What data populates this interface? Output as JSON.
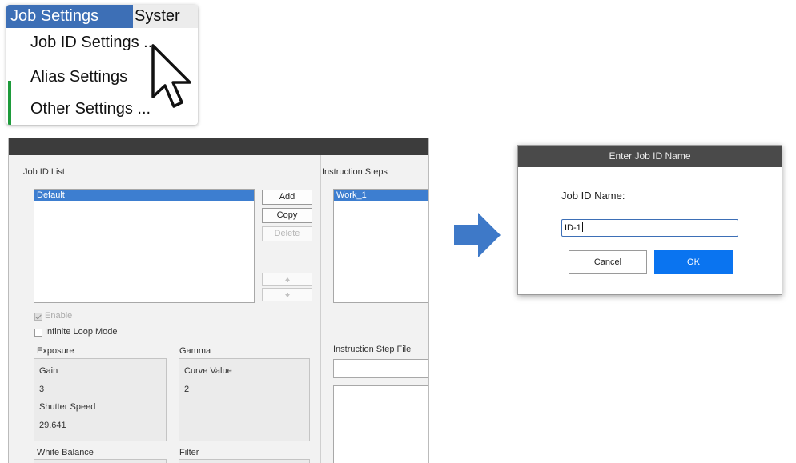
{
  "menu": {
    "active_menu": "Job Settings",
    "next_menu": "Syster",
    "items": [
      "Job ID Settings ...",
      "Alias Settings",
      "Other Settings ..."
    ]
  },
  "main_window": {
    "job_id_list_label": "Job ID List",
    "job_id_list": [
      "Default"
    ],
    "add_label": "Add",
    "copy_label": "Copy",
    "delete_label": "Delete",
    "up_icon": "arrow-up-icon",
    "down_icon": "arrow-down-icon",
    "enable_label": "Enable",
    "enable_checked": true,
    "infinite_loop_label": "Infinite Loop Mode",
    "infinite_loop_checked": false,
    "exposure": {
      "title": "Exposure",
      "gain_label": "Gain",
      "gain_value": "3",
      "shutter_label": "Shutter Speed",
      "shutter_value": "29.641"
    },
    "gamma": {
      "title": "Gamma",
      "curve_label": "Curve Value",
      "curve_value": "2"
    },
    "white_balance_title": "White Balance",
    "filter_title": "Filter",
    "instruction_steps_label": "Instruction Steps",
    "instruction_steps": [
      "Work_1"
    ],
    "instruction_step_file_label": "Instruction Step File",
    "instruction_step_file_value": ""
  },
  "arrow_icon": "right-arrow-icon",
  "dialog": {
    "title": "Enter Job ID Name",
    "field_label": "Job ID Name:",
    "field_value": "ID-1",
    "cancel_label": "Cancel",
    "ok_label": "OK"
  },
  "colors": {
    "menu_highlight": "#3d6fb6",
    "selection": "#3d7ed0",
    "ok_button": "#0a74f0",
    "arrow": "#3e79c8"
  }
}
